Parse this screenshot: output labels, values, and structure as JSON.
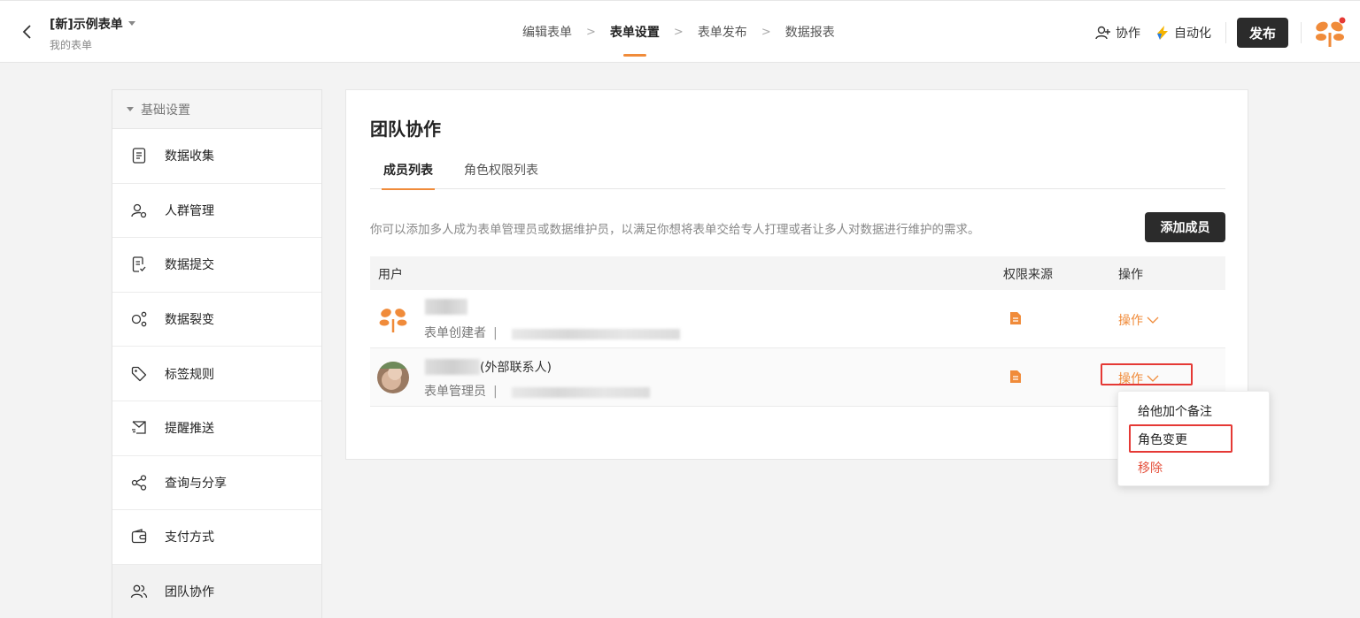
{
  "header": {
    "form_title": "[新]示例表单",
    "form_subtitle": "我的表单",
    "steps": [
      "编辑表单",
      "表单设置",
      "表单发布",
      "数据报表"
    ],
    "collab_label": "协作",
    "automation_label": "自动化",
    "publish_label": "发布"
  },
  "sidebar": {
    "group_label": "基础设置",
    "items": [
      {
        "label": "数据收集",
        "icon": "document-icon"
      },
      {
        "label": "人群管理",
        "icon": "people-settings-icon"
      },
      {
        "label": "数据提交",
        "icon": "submit-doc-icon"
      },
      {
        "label": "数据裂变",
        "icon": "fission-icon"
      },
      {
        "label": "标签规则",
        "icon": "tag-icon"
      },
      {
        "label": "提醒推送",
        "icon": "push-icon"
      },
      {
        "label": "查询与分享",
        "icon": "share-icon"
      },
      {
        "label": "支付方式",
        "icon": "wallet-icon"
      },
      {
        "label": "团队协作",
        "icon": "team-icon"
      }
    ]
  },
  "main": {
    "title": "团队协作",
    "tabs": [
      "成员列表",
      "角色权限列表"
    ],
    "description": "你可以添加多人成为表单管理员或数据维护员，以满足你想将表单交给专人打理或者让多人对数据进行维护的需求。",
    "add_member_label": "添加成员",
    "columns": {
      "user": "用户",
      "source": "权限来源",
      "action": "操作"
    },
    "rows": [
      {
        "name_suffix": "",
        "role": "表单创建者",
        "action": "操作"
      },
      {
        "name_suffix": "(外部联系人)",
        "role": "表单管理员",
        "action": "操作"
      }
    ]
  },
  "dropdown": {
    "items": [
      "给他加个备注",
      "角色变更",
      "移除"
    ]
  },
  "colors": {
    "accent": "#f08b3a",
    "dark_button": "#2b2b2b",
    "highlight_box": "#e53935",
    "danger": "#e5523e"
  }
}
